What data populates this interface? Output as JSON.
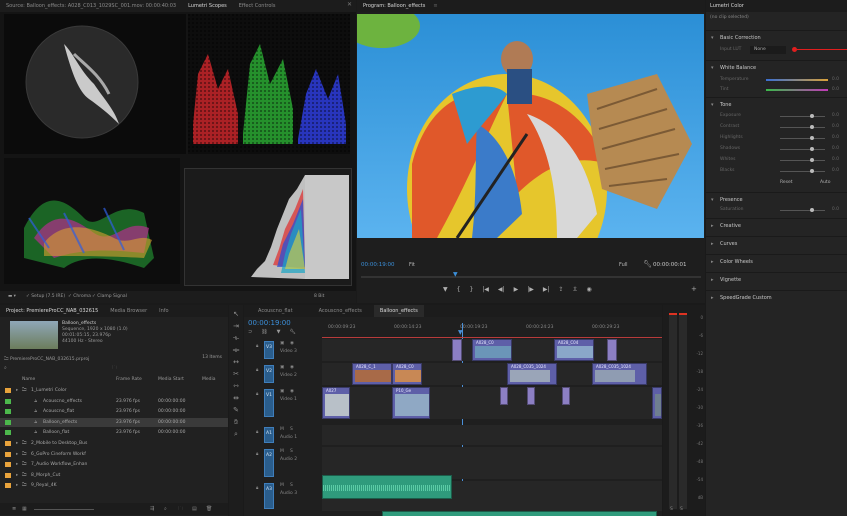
{
  "source_panel": {
    "tabs": [
      "Source: Balloon_effects: A028_C013_1029SC_001.mov: 00:00:40:03",
      "Lumetri Scopes",
      "Effect Controls"
    ],
    "active_tab": "Lumetri Scopes",
    "footer": {
      "preset": "Setup (7.5 IRE)",
      "chroma_label": "Chroma",
      "clamp_label": "Clamp Signal",
      "bits": "8 Bit"
    }
  },
  "program_panel": {
    "title": "Program: Balloon_effects",
    "timecode_left": "00:00:19:00",
    "zoom": "Fit",
    "quality": "Full",
    "timecode_right": "00:00:00:01"
  },
  "lumetri_panel": {
    "title": "Lumetri Color",
    "subtitle": "(no clip selected)",
    "sections": [
      {
        "label": "Basic Correction",
        "expanded": true
      },
      {
        "label": "White Balance",
        "expanded": true
      },
      {
        "label": "Tone",
        "expanded": true
      },
      {
        "label": "Presence",
        "expanded": true
      },
      {
        "label": "Creative",
        "expanded": false
      },
      {
        "label": "Curves",
        "expanded": false
      },
      {
        "label": "Color Wheels",
        "expanded": false
      },
      {
        "label": "Vignette",
        "expanded": false
      },
      {
        "label": "SpeedGrade Custom",
        "expanded": false
      }
    ],
    "input_lut_label": "Input LUT",
    "input_lut_value": "None",
    "wb_rows": [
      "Temperature",
      "Tint"
    ],
    "tone_rows": [
      "Exposure",
      "Contrast",
      "Highlights",
      "Shadows",
      "Whites",
      "Blacks"
    ],
    "reset_label": "Reset",
    "auto_label": "Auto",
    "presence_rows": [
      "Saturation"
    ],
    "slider_value": "0.0"
  },
  "project_panel": {
    "tabs": [
      "Project: PremiereProCC_NAB_032615",
      "Media Browser",
      "Info"
    ],
    "clip_name": "Balloon_effects",
    "clip_info1": "Sequence, 1920 x 1080 (1.0)",
    "clip_info2": "00:01:05:15, 23.976p",
    "clip_info3": "44100 Hz - Stereo",
    "project_file": "PremiereProCC_NAB_032615.prproj",
    "item_count": "13 Items",
    "columns": [
      "Name",
      "Frame Rate",
      "Media Start",
      "Media"
    ],
    "rows": [
      {
        "name": "1_Lumetri Color",
        "rate": "",
        "start": "",
        "indent": 0,
        "type": "folder",
        "color": "#e8a33c"
      },
      {
        "name": "Acouscno_effects",
        "rate": "23.976 fps",
        "start": "00:00:00:00",
        "indent": 1,
        "type": "seq",
        "color": "#4cb84c"
      },
      {
        "name": "Acouscno_flat",
        "rate": "23.976 fps",
        "start": "00:00:00:00",
        "indent": 1,
        "type": "seq",
        "color": "#4cb84c"
      },
      {
        "name": "Balloon_effects",
        "rate": "23.976 fps",
        "start": "00:00:00:00",
        "indent": 1,
        "type": "seq",
        "color": "#4cb84c"
      },
      {
        "name": "Balloon_flat",
        "rate": "23.976 fps",
        "start": "00:00:00:00",
        "indent": 1,
        "type": "seq",
        "color": "#4cb84c"
      },
      {
        "name": "2_Mobile to Desktop_Bus",
        "rate": "",
        "start": "",
        "indent": 0,
        "type": "folder",
        "color": "#e8a33c"
      },
      {
        "name": "6_GoPro Cineform Workf",
        "rate": "",
        "start": "",
        "indent": 0,
        "type": "folder",
        "color": "#e8a33c"
      },
      {
        "name": "7_Audio Workflow_Enhan",
        "rate": "",
        "start": "",
        "indent": 0,
        "type": "folder",
        "color": "#e8a33c"
      },
      {
        "name": "8_Morph_Cut",
        "rate": "",
        "start": "",
        "indent": 0,
        "type": "folder",
        "color": "#e8a33c"
      },
      {
        "name": "9_Reyal_4K",
        "rate": "",
        "start": "",
        "indent": 0,
        "type": "folder",
        "color": "#e8a33c"
      }
    ]
  },
  "timeline_panel": {
    "tabs": [
      "Acouscno_flat",
      "Acouscno_effects",
      "Balloon_effects"
    ],
    "active_tab": "Balloon_effects",
    "timecode": "00:00:19:00",
    "ruler": [
      "00:00:09:23",
      "00:00:14:23",
      "00:00:19:23",
      "00:00:24:23",
      "00:00:29:23"
    ],
    "video_tracks": [
      "Video 3",
      "Video 2",
      "Video 1"
    ],
    "track_ids_v": [
      "V3",
      "V2",
      "V1"
    ],
    "audio_tracks": [
      "Audio 1",
      "Audio 2",
      "Audio 3"
    ],
    "track_ids_a": [
      "A1",
      "A2",
      "A3"
    ],
    "clip_labels": [
      "A028_C0",
      "A028_C04",
      "A028_C_1",
      "A028_C0",
      "A028_C035_1024",
      "A028_C035_1024",
      "A027",
      "P10_Ge"
    ]
  },
  "meter_labels": [
    "0",
    "-6",
    "-12",
    "-18",
    "-24",
    "-30",
    "-36",
    "-42",
    "-48",
    "-54",
    "dB"
  ],
  "colors": {
    "accent": "#3b8fd9",
    "playhead": "#4a90d9",
    "record": "#e01e1e"
  }
}
